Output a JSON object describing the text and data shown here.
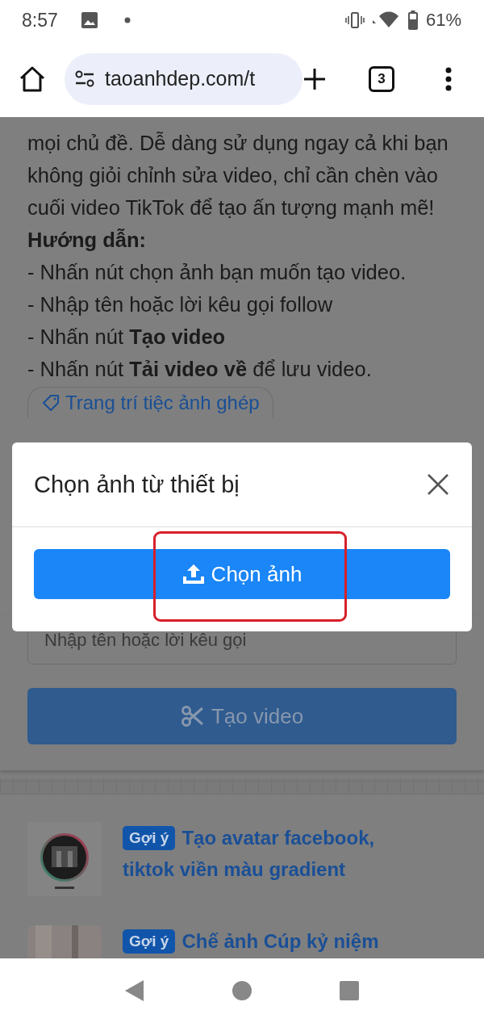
{
  "status_bar": {
    "time": "8:57",
    "battery": "61%"
  },
  "browser": {
    "url": "taoanhdep.com/t",
    "tab_count": "3"
  },
  "article": {
    "paragraph": "mọi chủ đề. Dễ dàng sử dụng ngay cả khi bạn không giỏi chỉnh sửa video, chỉ cần chèn vào cuối video TikTok để tạo ấn tượng mạnh mẽ!",
    "heading": "Hướng dẫn:",
    "steps": [
      "- Nhấn nút chọn ảnh bạn muốn tạo video.",
      "- Nhập tên hoặc lời kêu gọi follow",
      "- Nhấn nút **Tạo video**",
      "- Nhấn nút **Tải video về** để lưu video."
    ],
    "tag": "Trang trí tiệc ảnh ghép"
  },
  "form": {
    "name_placeholder": "Nhập tên hoặc lời kêu gọi",
    "create_button": "Tạo video"
  },
  "suggestions": [
    {
      "badge": "Gợi ý",
      "title": "Tạo avatar facebook, tiktok viền màu gradient",
      "kind": "picture"
    },
    {
      "badge": "Gợi ý",
      "title": "Chế ảnh Cúp kỷ niệm",
      "kind": "picture"
    }
  ],
  "modal": {
    "title": "Chọn ảnh từ thiết bị",
    "button": "Chọn ảnh",
    "highlighted": true
  }
}
